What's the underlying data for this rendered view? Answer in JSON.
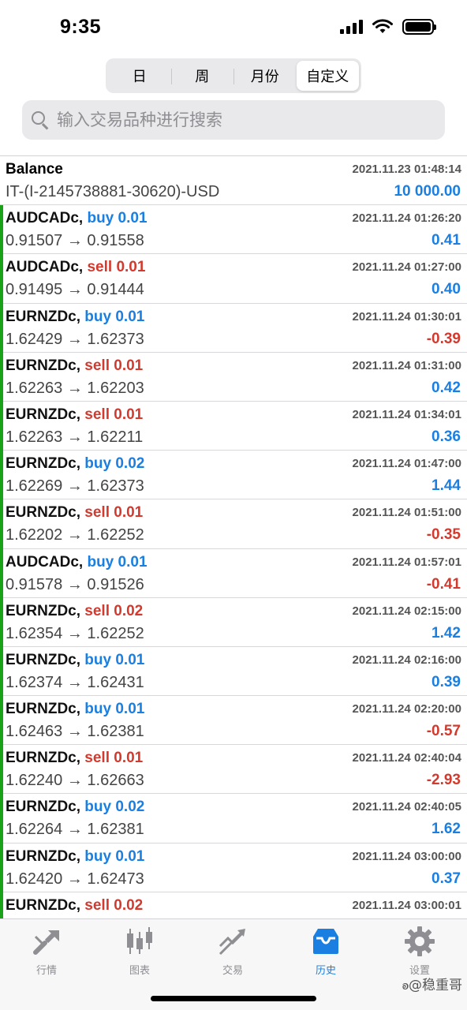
{
  "status_bar": {
    "time": "9:35"
  },
  "period_tabs": [
    {
      "label": "日",
      "active": false
    },
    {
      "label": "周",
      "active": false
    },
    {
      "label": "月份",
      "active": false
    },
    {
      "label": "自定义",
      "active": true
    }
  ],
  "search": {
    "placeholder": "输入交易品种进行搜索"
  },
  "balance": {
    "title": "Balance",
    "datetime": "2021.11.23 01:48:14",
    "comment": "IT-(I-2145738881-30620)-USD",
    "amount": "10 000.00"
  },
  "trades": [
    {
      "symbol": "AUDCADc,",
      "side": "buy 0.01",
      "type": "buy",
      "prices": "0.91507 → 0.91558",
      "datetime": "2021.11.24 01:26:20",
      "profit": "0.41"
    },
    {
      "symbol": "AUDCADc,",
      "side": "sell 0.01",
      "type": "sell",
      "prices": "0.91495 → 0.91444",
      "datetime": "2021.11.24 01:27:00",
      "profit": "0.40"
    },
    {
      "symbol": "EURNZDc,",
      "side": "buy 0.01",
      "type": "buy",
      "prices": "1.62429 → 1.62373",
      "datetime": "2021.11.24 01:30:01",
      "profit": "-0.39"
    },
    {
      "symbol": "EURNZDc,",
      "side": "sell 0.01",
      "type": "sell",
      "prices": "1.62263 → 1.62203",
      "datetime": "2021.11.24 01:31:00",
      "profit": "0.42"
    },
    {
      "symbol": "EURNZDc,",
      "side": "sell 0.01",
      "type": "sell",
      "prices": "1.62263 → 1.62211",
      "datetime": "2021.11.24 01:34:01",
      "profit": "0.36"
    },
    {
      "symbol": "EURNZDc,",
      "side": "buy 0.02",
      "type": "buy",
      "prices": "1.62269 → 1.62373",
      "datetime": "2021.11.24 01:47:00",
      "profit": "1.44"
    },
    {
      "symbol": "EURNZDc,",
      "side": "sell 0.01",
      "type": "sell",
      "prices": "1.62202 → 1.62252",
      "datetime": "2021.11.24 01:51:00",
      "profit": "-0.35"
    },
    {
      "symbol": "AUDCADc,",
      "side": "buy 0.01",
      "type": "buy",
      "prices": "0.91578 → 0.91526",
      "datetime": "2021.11.24 01:57:01",
      "profit": "-0.41"
    },
    {
      "symbol": "EURNZDc,",
      "side": "sell 0.02",
      "type": "sell",
      "prices": "1.62354 → 1.62252",
      "datetime": "2021.11.24 02:15:00",
      "profit": "1.42"
    },
    {
      "symbol": "EURNZDc,",
      "side": "buy 0.01",
      "type": "buy",
      "prices": "1.62374 → 1.62431",
      "datetime": "2021.11.24 02:16:00",
      "profit": "0.39"
    },
    {
      "symbol": "EURNZDc,",
      "side": "buy 0.01",
      "type": "buy",
      "prices": "1.62463 → 1.62381",
      "datetime": "2021.11.24 02:20:00",
      "profit": "-0.57"
    },
    {
      "symbol": "EURNZDc,",
      "side": "sell 0.01",
      "type": "sell",
      "prices": "1.62240 → 1.62663",
      "datetime": "2021.11.24 02:40:04",
      "profit": "-2.93"
    },
    {
      "symbol": "EURNZDc,",
      "side": "buy 0.02",
      "type": "buy",
      "prices": "1.62264 → 1.62381",
      "datetime": "2021.11.24 02:40:05",
      "profit": "1.62"
    },
    {
      "symbol": "EURNZDc,",
      "side": "buy 0.01",
      "type": "buy",
      "prices": "1.62420 → 1.62473",
      "datetime": "2021.11.24 03:00:00",
      "profit": "0.37"
    },
    {
      "symbol": "EURNZDc,",
      "side": "sell 0.02",
      "type": "sell",
      "prices": "",
      "datetime": "2021.11.24 03:00:01",
      "profit": ""
    }
  ],
  "tabbar": [
    {
      "label": "行情",
      "icon": "quotes-icon",
      "active": false
    },
    {
      "label": "图表",
      "icon": "candlestick-chart-icon",
      "active": false
    },
    {
      "label": "交易",
      "icon": "trade-icon",
      "active": false
    },
    {
      "label": "历史",
      "icon": "history-inbox-icon",
      "active": true
    },
    {
      "label": "设置",
      "icon": "gear-icon",
      "active": false
    }
  ],
  "watermark": "ꭷ@稳重哥",
  "colors": {
    "accent": "#1a7fe0",
    "sell": "#d13a2e",
    "trade_marker": "#1aa11a"
  }
}
